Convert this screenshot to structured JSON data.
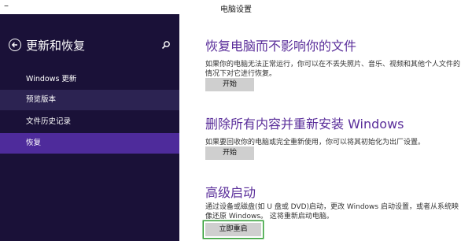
{
  "window": {
    "title": "电脑设置",
    "minimize_icon": "minimize-icon"
  },
  "sidebar": {
    "heading": "更新和恢复",
    "items": [
      {
        "label": "Windows 更新"
      },
      {
        "label": "预览版本"
      },
      {
        "label": "文件历史记录"
      },
      {
        "label": "恢复",
        "selected": true
      }
    ],
    "colors": {
      "background": "#1a1138",
      "selected": "#4e2b9b",
      "hover": "#2c2352"
    }
  },
  "main": {
    "sections": [
      {
        "title": "恢复电脑而不影响你的文件",
        "description": "如果你的电脑无法正常运行，你可以在不丢失照片、音乐、视频和其他个人文件的情况下对它进行恢复。",
        "button": "开始"
      },
      {
        "title": "删除所有内容并重新安装 Windows",
        "description": "如果要回收你的电脑或完全重新使用，你可以将其初始化为出厂设置。",
        "button": "开始"
      },
      {
        "title": "高级启动",
        "description": "通过设备或磁盘(如 U 盘或 DVD)启动，更改 Windows 启动设置，或者从系统映像还原 Windows。 这将重新启动电脑。",
        "button": "立即重启"
      }
    ],
    "colors": {
      "title": "#5a2e9a",
      "button_bg": "#cfcfcf",
      "highlight": "#2f9e33"
    }
  }
}
